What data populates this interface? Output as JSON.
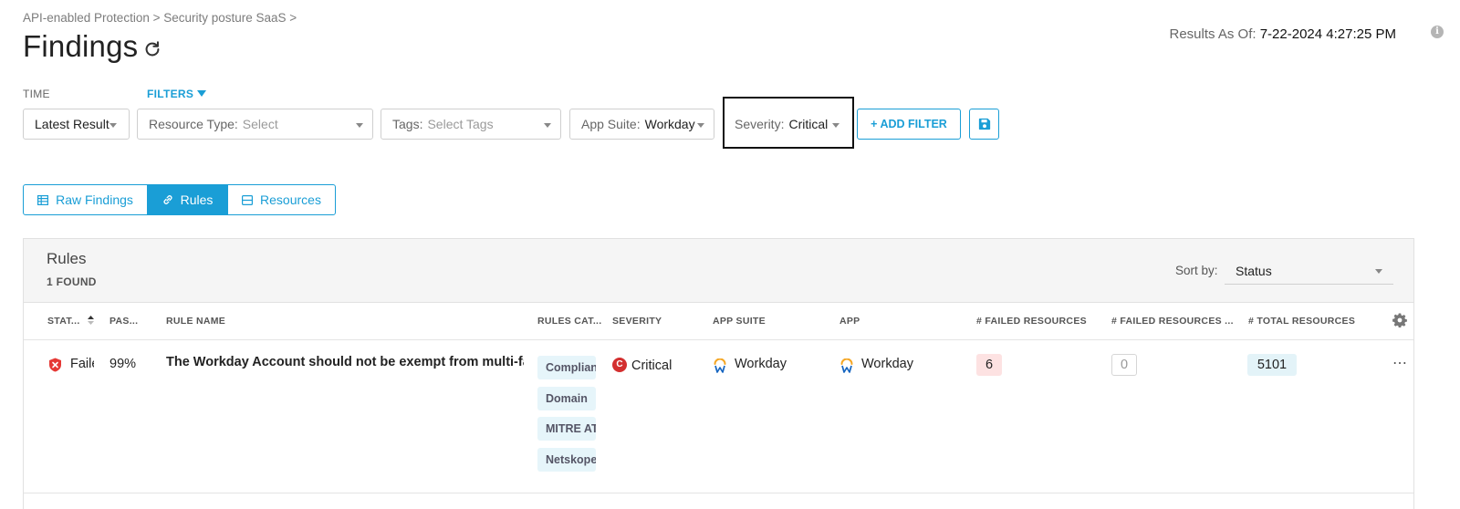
{
  "header": {
    "breadcrumb": "API-enabled Protection > Security posture SaaS >",
    "title": "Findings",
    "results_label": "Results As Of:",
    "results_value": "7-22-2024 4:27:25 PM"
  },
  "filters": {
    "time_label": "TIME",
    "filters_label": "FILTERS",
    "time_value": "Latest Result",
    "resource_type": {
      "label": "Resource Type:",
      "placeholder": "Select"
    },
    "tags": {
      "label": "Tags:",
      "placeholder": "Select Tags"
    },
    "app_suite": {
      "label": "App Suite:",
      "value": "Workday"
    },
    "severity": {
      "label": "Severity:",
      "value": "Critical"
    },
    "add_filter_label": "+ ADD FILTER"
  },
  "tabs": [
    {
      "label": "Raw Findings",
      "icon": "table-icon",
      "active": false
    },
    {
      "label": "Rules",
      "icon": "link-icon",
      "active": true
    },
    {
      "label": "Resources",
      "icon": "resources-icon",
      "active": false
    }
  ],
  "panel": {
    "title": "Rules",
    "count": "1 FOUND",
    "sort_by_label": "Sort by:",
    "sort_by_value": "Status"
  },
  "table": {
    "columns": [
      "STAT...",
      "PAS...",
      "RULE NAME",
      "RULES CAT...",
      "SEVERITY",
      "APP SUITE",
      "APP",
      "# FAILED RESOURCES",
      "# FAILED RESOURCES ...",
      "# TOTAL RESOURCES"
    ],
    "rows": [
      {
        "status": "Faile",
        "pass_rate": "99%",
        "rule_name": "The Workday Account should not be exempt from multi-fa...",
        "categories": [
          "Complian",
          "Domain",
          "MITRE AT",
          "Netskope"
        ],
        "severity_badge": "C",
        "severity": "Critical",
        "app_suite": "Workday",
        "app": "Workday",
        "failed_resources": "6",
        "failed_resources_2": "0",
        "total_resources": "5101"
      }
    ]
  },
  "colors": {
    "accent": "#1a9ed6",
    "critical": "#d32f2f",
    "fail_pill": "#fde2e2",
    "total_pill": "#e3f3f8"
  }
}
